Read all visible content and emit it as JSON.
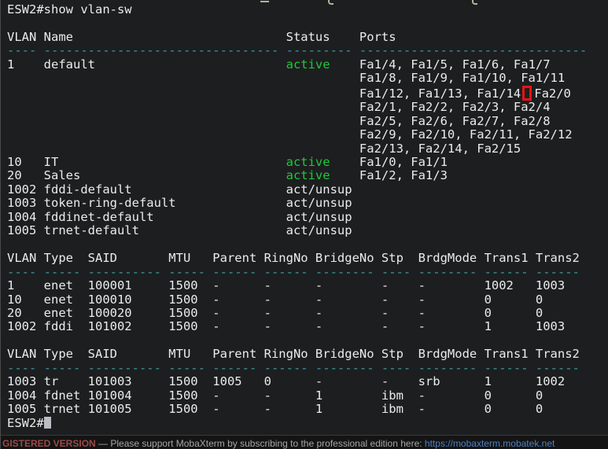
{
  "colors": {
    "background": "#1d1e1f",
    "foreground": "#e9ecee",
    "separator_cyan": "#3a9aa6",
    "active_green": "#1ec83c",
    "cursor_gray": "#b9bdc4",
    "annotation_red": "#e61414",
    "statusbar_version_red": "#9a4a4a",
    "statusbar_text_gray": "#a6a6a6",
    "statusbar_url_blue": "#4f80c0"
  },
  "terminal": {
    "device_prompt": "ESW2#",
    "command": "show vlan-sw",
    "lines": [
      [
        {
          "t": "ESW2#show vlan-sw"
        }
      ],
      [],
      [
        {
          "t": "VLAN Name                             Status    Ports"
        }
      ],
      [
        {
          "t": "---- -------------------------------- --------- -------------------------------",
          "s": "cyan"
        }
      ],
      [
        {
          "t": "1    default                          "
        },
        {
          "t": "active",
          "s": "green"
        },
        {
          "t": "    Fa1/4, Fa1/5, Fa1/6, Fa1/7"
        }
      ],
      [
        {
          "t": "                                                Fa1/8, Fa1/9, Fa1/10, Fa1/11"
        }
      ],
      [
        {
          "t": "                                                Fa1/12, Fa1/13, Fa1/14"
        },
        {
          "box": true
        },
        {
          "t": "Fa2/0"
        }
      ],
      [
        {
          "t": "                                                Fa2/1, Fa2/2, Fa2/3, Fa2/4"
        }
      ],
      [
        {
          "t": "                                                Fa2/5, Fa2/6, Fa2/7, Fa2/8"
        }
      ],
      [
        {
          "t": "                                                Fa2/9, Fa2/10, Fa2/11, Fa2/12"
        }
      ],
      [
        {
          "t": "                                                Fa2/13, Fa2/14, Fa2/15"
        }
      ],
      [
        {
          "t": "10   IT                               "
        },
        {
          "t": "active",
          "s": "green"
        },
        {
          "t": "    Fa1/0, Fa1/1"
        }
      ],
      [
        {
          "t": "20   Sales                            "
        },
        {
          "t": "active",
          "s": "green"
        },
        {
          "t": "    Fa1/2, Fa1/3"
        }
      ],
      [
        {
          "t": "1002 fddi-default                     act/unsup"
        }
      ],
      [
        {
          "t": "1003 token-ring-default               act/unsup"
        }
      ],
      [
        {
          "t": "1004 fddinet-default                  act/unsup"
        }
      ],
      [
        {
          "t": "1005 trnet-default                    act/unsup"
        }
      ],
      [],
      [
        {
          "t": "VLAN Type  SAID       MTU   Parent RingNo BridgeNo Stp  BrdgMode Trans1 Trans2"
        }
      ],
      [
        {
          "t": "---- ----- ---------- ----- ------ ------ -------- ---- -------- ------ ------",
          "s": "cyan"
        }
      ],
      [
        {
          "t": "1    enet  100001     1500  -      -      -        -    -        1002   1003"
        }
      ],
      [
        {
          "t": "10   enet  100010     1500  -      -      -        -    -        0      0"
        }
      ],
      [
        {
          "t": "20   enet  100020     1500  -      -      -        -    -        0      0"
        }
      ],
      [
        {
          "t": "1002 fddi  101002     1500  -      -      -        -    -        1      1003"
        }
      ],
      [],
      [
        {
          "t": "VLAN Type  SAID       MTU   Parent RingNo BridgeNo Stp  BrdgMode Trans1 Trans2"
        }
      ],
      [
        {
          "t": "---- ----- ---------- ----- ------ ------ -------- ---- -------- ------ ------",
          "s": "cyan"
        }
      ],
      [
        {
          "t": "1003 tr    101003     1500  1005   0      -        -    srb      1      1002"
        }
      ],
      [
        {
          "t": "1004 fdnet 101004     1500  -      -      1        ibm  -        0      0"
        }
      ],
      [
        {
          "t": "1005 trnet 101005     1500  -      -      1        ibm  -        0      0"
        }
      ],
      [
        {
          "t": "ESW2#"
        },
        {
          "cursor": true
        }
      ]
    ]
  },
  "status_bar": {
    "segments": [
      {
        "t": "GISTERED VERSION",
        "s": "ver"
      },
      {
        "t": "  —  Please support MobaXterm by subscribing to the professional edition here:  ",
        "s": "msg"
      },
      {
        "t": "https://mobaxterm.mobatek.net",
        "s": "url"
      }
    ]
  }
}
